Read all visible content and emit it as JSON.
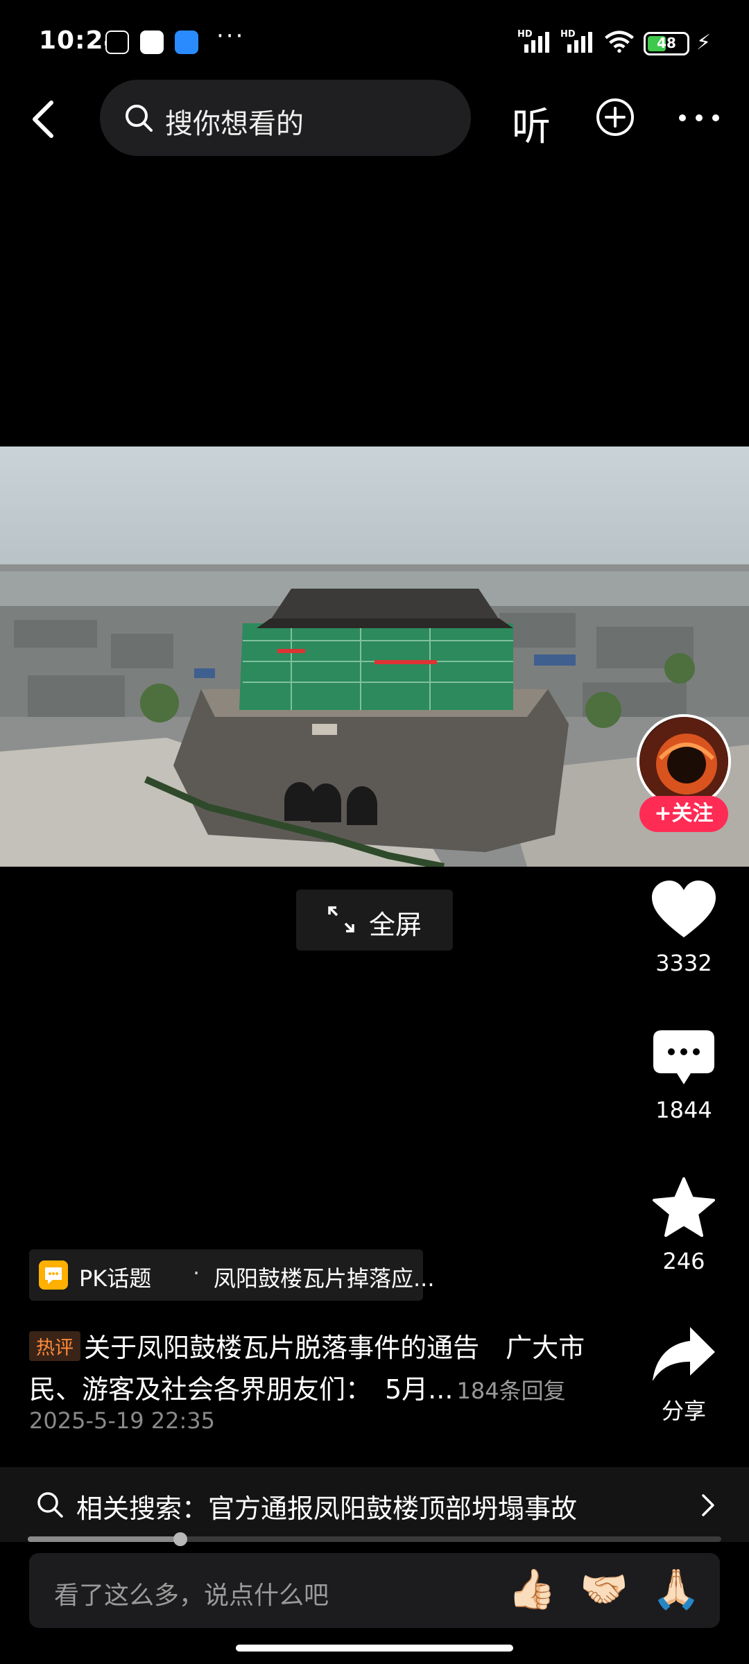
{
  "status_bar": {
    "time": "10:24",
    "battery": "48",
    "battery_level": 0.48,
    "more": "···",
    "hd_label": "HD"
  },
  "nav": {
    "search_placeholder": "搜你想看的",
    "listen_label": "听"
  },
  "video": {
    "fullscreen_label": "全屏"
  },
  "author": {
    "follow_label": "+关注"
  },
  "actions": {
    "likes": "3332",
    "comments": "1844",
    "favorites": "246",
    "share_label": "分享"
  },
  "pk_topic": {
    "label": "PK话题",
    "separator": "·",
    "title": "凤阳鼓楼瓦片掉落应..."
  },
  "hot_comment": {
    "badge": "热评",
    "text": "关于凤阳鼓楼瓦片脱落事件的通告　广大市民、游客及社会各界朋友们：　5月...",
    "reply_count": "184条回复",
    "time": "2025-5-19 22:35"
  },
  "related_search": {
    "text": "相关搜索：官方通报凤阳鼓楼顶部坍塌事故"
  },
  "playback": {
    "progress": 0.22
  },
  "comment_input": {
    "placeholder": "看了这么多，说点什么吧",
    "emojis": [
      "👍🏻",
      "🤝🏻",
      "🙏🏻"
    ]
  },
  "colors": {
    "accent": "#fe2c55",
    "hot_badge": "#ff8b3b",
    "pk_icon": "#ffb000"
  }
}
